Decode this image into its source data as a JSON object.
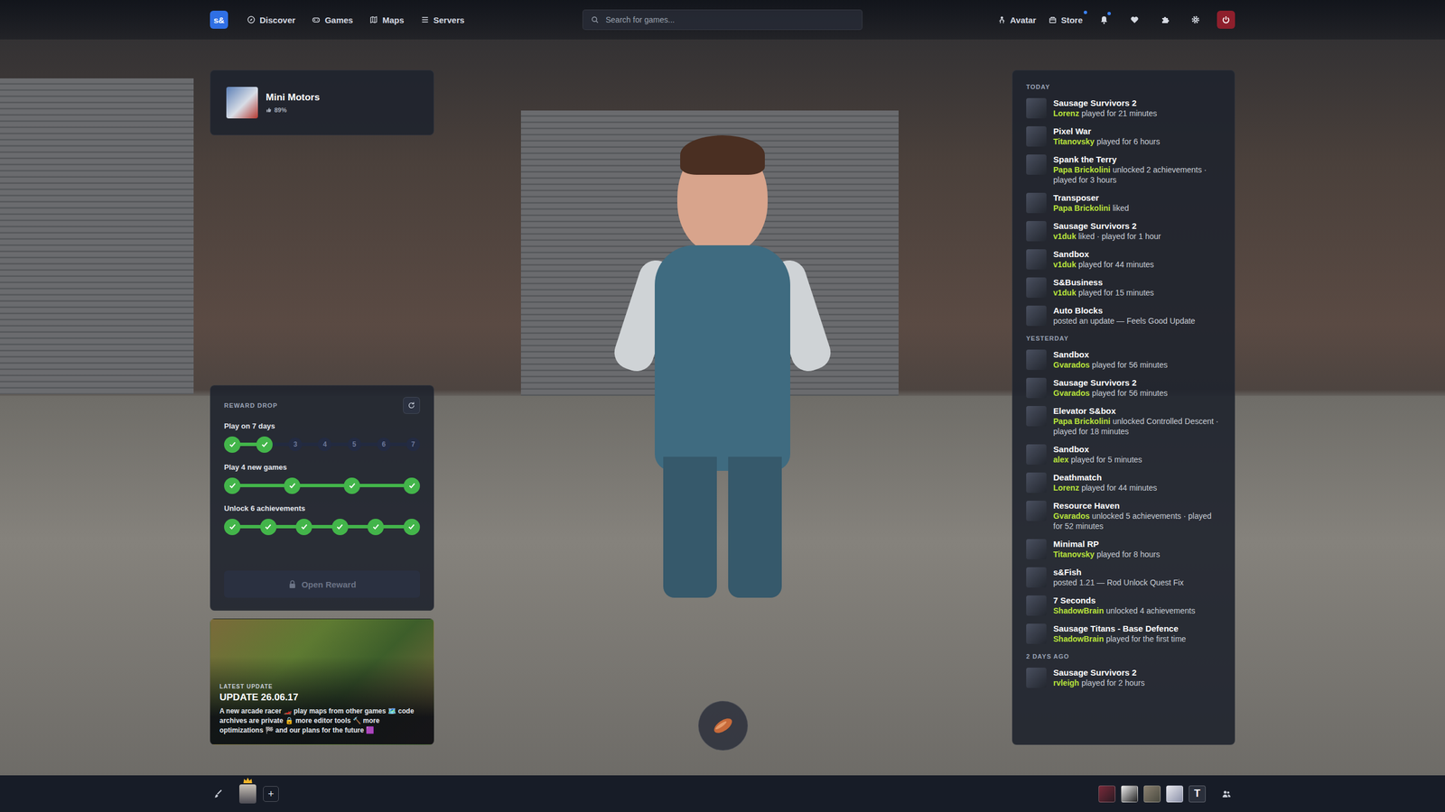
{
  "nav": {
    "logo": "s&",
    "items": [
      {
        "label": "Discover",
        "selected": false
      },
      {
        "label": "Games",
        "selected": false
      },
      {
        "label": "Maps",
        "selected": false
      },
      {
        "label": "Servers",
        "selected": false
      }
    ],
    "search": {
      "placeholder": "Search for games..."
    },
    "links": [
      {
        "label": "Avatar",
        "dot": false
      },
      {
        "label": "Store",
        "dot": true
      }
    ],
    "notifications": {
      "dot": true
    }
  },
  "featured": {
    "title": "Mini Motors",
    "rating": "89%"
  },
  "reward": {
    "title": "REWARD DROP",
    "tasks": [
      {
        "label": "Play on 7 days",
        "steps": [
          {
            "done": true
          },
          {
            "done": true
          },
          {
            "done": false,
            "label": "3"
          },
          {
            "done": false,
            "label": "4"
          },
          {
            "done": false,
            "label": "5"
          },
          {
            "done": false,
            "label": "6"
          },
          {
            "done": false,
            "label": "7"
          }
        ]
      },
      {
        "label": "Play 4 new games",
        "steps": [
          {
            "done": true
          },
          {
            "done": true
          },
          {
            "done": true
          },
          {
            "done": true
          }
        ]
      },
      {
        "label": "Unlock 6 achievements",
        "steps": [
          {
            "done": true
          },
          {
            "done": true
          },
          {
            "done": true
          },
          {
            "done": true
          },
          {
            "done": true
          },
          {
            "done": true
          }
        ]
      }
    ],
    "button": {
      "label": "Open Reward",
      "disabled": true
    }
  },
  "latest_update": {
    "label": "LATEST UPDATE",
    "title": "UPDATE 26.06.17",
    "text": "A new arcade racer 🏎️ play maps from other games 🗺️ code archives are private 🔒 more editor tools 🔨 more optimizations 🏁 and our plans for the future 🟪"
  },
  "activity": {
    "groups": [
      {
        "label": "TODAY",
        "items": [
          {
            "game": "Sausage Survivors 2",
            "user": "Lorenz",
            "action": "played for 21 minutes"
          },
          {
            "game": "Pixel War",
            "user": "Titanovsky",
            "action": "played for 6 hours"
          },
          {
            "game": "Spank the Terry",
            "user": "Papa Brickolini",
            "action": "unlocked 2 achievements · played for 3 hours"
          },
          {
            "game": "Transposer",
            "user": "Papa Brickolini",
            "action": "liked"
          },
          {
            "game": "Sausage Survivors 2",
            "user": "v1duk",
            "action": "liked · played for 1 hour"
          },
          {
            "game": "Sandbox",
            "user": "v1duk",
            "action": "played for 44 minutes"
          },
          {
            "game": "S&Business",
            "user": "v1duk",
            "action": "played for 15 minutes"
          },
          {
            "game": "Auto Blocks",
            "user": "",
            "action": "posted an update — Feels Good Update"
          }
        ]
      },
      {
        "label": "YESTERDAY",
        "items": [
          {
            "game": "Sandbox",
            "user": "Gvarados",
            "action": "played for 56 minutes"
          },
          {
            "game": "Sausage Survivors 2",
            "user": "Gvarados",
            "action": "played for 56 minutes"
          },
          {
            "game": "Elevator S&box",
            "user": "Papa Brickolini",
            "action": "unlocked Controlled Descent · played for 18 minutes"
          },
          {
            "game": "Sandbox",
            "user": "alex",
            "action": "played for 5 minutes"
          },
          {
            "game": "Deathmatch",
            "user": "Lorenz",
            "action": "played for 44 minutes"
          },
          {
            "game": "Resource Haven",
            "user": "Gvarados",
            "action": "unlocked 5 achievements · played for 52 minutes"
          },
          {
            "game": "Minimal RP",
            "user": "Titanovsky",
            "action": "played for 8 hours"
          },
          {
            "game": "s&Fish",
            "user": "",
            "action": "posted 1.21 — Rod Unlock Quest Fix"
          },
          {
            "game": "7 Seconds",
            "user": "ShadowBrain",
            "action": "unlocked 4 achievements"
          },
          {
            "game": "Sausage Titans - Base Defence",
            "user": "ShadowBrain",
            "action": "played for the first time"
          }
        ]
      },
      {
        "label": "2 DAYS AGO",
        "items": [
          {
            "game": "Sausage Survivors 2",
            "user": "rvleigh",
            "action": "played for 2 hours"
          }
        ]
      }
    ]
  },
  "bottom_bar": {
    "add_label": "+",
    "friends": [
      {
        "kind": "avatar"
      },
      {
        "kind": "avatar"
      },
      {
        "kind": "avatar"
      },
      {
        "kind": "avatar"
      },
      {
        "kind": "letter",
        "label": "T"
      }
    ]
  }
}
